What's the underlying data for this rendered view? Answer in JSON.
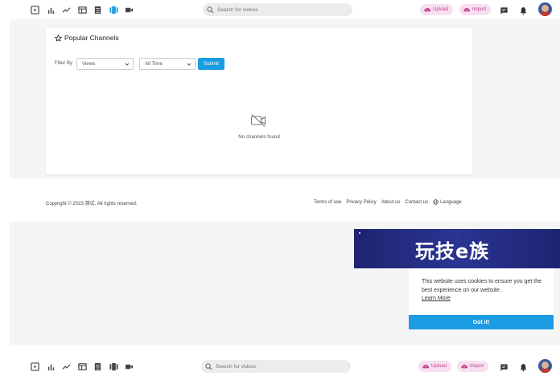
{
  "header": {
    "nav_icons": [
      "video-library-icon",
      "bar-chart-icon",
      "trending-icon",
      "browser-window-icon",
      "list-icon",
      "channels-icon",
      "camera-icon"
    ],
    "search_placeholder": "Search for videos",
    "upload_label": "Upload",
    "import_label": "Import",
    "accent_color": "#c2408d"
  },
  "main": {
    "title": "Popular Channels",
    "filter_label": "Filter By",
    "sort_value": "Views",
    "time_value": "All Time",
    "submit_label": "Submit",
    "empty_message": "No channels found"
  },
  "footer": {
    "copyright": "Copyright © 2023 测试. All rights reserved.",
    "links": [
      "Terms of use",
      "Privacy Policy",
      "About us",
      "Contact us"
    ],
    "language_label": "Language"
  },
  "banner": {
    "text": "玩技e族"
  },
  "cookie": {
    "message": "This website uses cookies to ensure you get the best experience on our website.",
    "learn_more": "Learn More",
    "accept_label": "Got it!",
    "button_color": "#1b9ce2"
  }
}
